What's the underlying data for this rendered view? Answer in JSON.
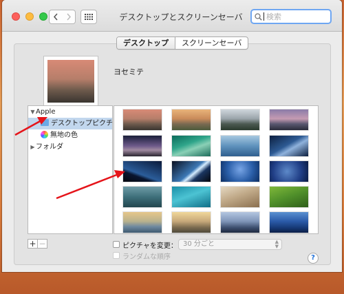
{
  "window": {
    "title": "デスクトップとスクリーンセーバ",
    "search_placeholder": "検索"
  },
  "tabs": [
    {
      "label": "デスクトップ",
      "selected": true
    },
    {
      "label": "スクリーンセーバ",
      "selected": false
    }
  ],
  "preview": {
    "label": "ヨセミテ"
  },
  "sidebar": {
    "groups": [
      {
        "label": "Apple",
        "expanded": true,
        "items": [
          {
            "label": "デスクトップピクチャ",
            "selected": true,
            "icon": "folder-icon"
          },
          {
            "label": "無地の色",
            "selected": false,
            "icon": "color-wheel-icon"
          }
        ]
      },
      {
        "label": "フォルダ",
        "expanded": false,
        "items": []
      }
    ]
  },
  "thumbnails": [
    {
      "name": "yosemite-half-dome"
    },
    {
      "name": "el-capitan-sunset"
    },
    {
      "name": "yosemite-valley"
    },
    {
      "name": "half-dome-dusk"
    },
    {
      "name": "lake-night"
    },
    {
      "name": "green-wave"
    },
    {
      "name": "ocean-wave"
    },
    {
      "name": "galaxy"
    },
    {
      "name": "earth-horizon"
    },
    {
      "name": "earth-from-space"
    },
    {
      "name": "blue-stars"
    },
    {
      "name": "night-sky"
    },
    {
      "name": "cloud-texture"
    },
    {
      "name": "turquoise-water"
    },
    {
      "name": "sand-dunes"
    },
    {
      "name": "green-field"
    },
    {
      "name": "misty-forest"
    },
    {
      "name": "golden-sunrays"
    },
    {
      "name": "mountain-mist"
    },
    {
      "name": "blue-mountains"
    }
  ],
  "bottom": {
    "add_label": "+",
    "remove_label": "−",
    "change_picture_label": "ピクチャを変更：",
    "change_picture_checked": false,
    "interval_value": "30 分ごと",
    "random_order_label": "ランダムな順序",
    "random_order_checked": false,
    "help_label": "?"
  },
  "colors": {
    "annotation_arrow": "#e5141a",
    "selection": "#c2d7ee",
    "search_focus": "#6ea6f2"
  }
}
